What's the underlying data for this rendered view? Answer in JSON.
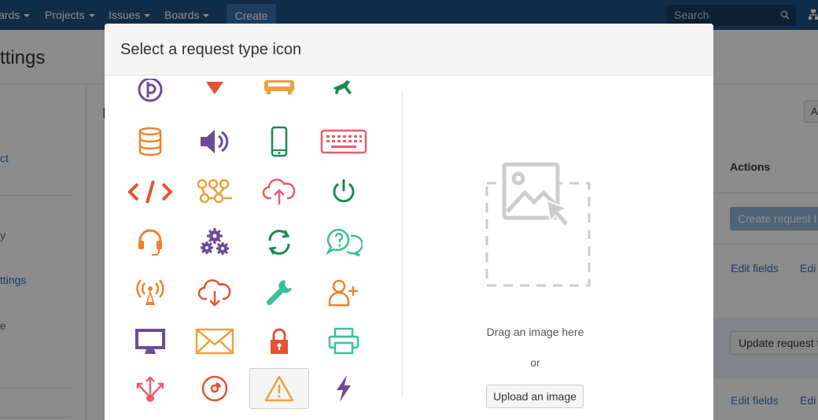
{
  "nav": {
    "items": [
      {
        "label": "ards"
      },
      {
        "label": "Projects"
      },
      {
        "label": "Issues"
      },
      {
        "label": "Boards"
      }
    ],
    "create_label": "Create",
    "search_placeholder": "Search"
  },
  "background": {
    "page_title": "ttings",
    "sidebar_links": [
      "ct",
      "y",
      "ttings",
      "e"
    ],
    "section_letter": "I",
    "small_button_label": "A",
    "actions_header": "Actions",
    "create_request_label": "Create request t",
    "edit_fields_label": "Edit fields",
    "edit_short_label": "Edi",
    "update_request_label": "Update request ty"
  },
  "modal": {
    "title": "Select a request type icon",
    "drop_text": "Drag an image here",
    "or_text": "or",
    "upload_label": "Upload an image"
  },
  "icons": [
    {
      "name": "currency-icon",
      "color": "#6b4c9a"
    },
    {
      "name": "heart-down-icon",
      "color": "#e5532f"
    },
    {
      "name": "couch-icon",
      "color": "#e8a23b"
    },
    {
      "name": "airplane-icon",
      "color": "#1b8a4c"
    },
    {
      "name": "database-icon",
      "color": "#f0812c"
    },
    {
      "name": "speaker-icon",
      "color": "#6b4c9a"
    },
    {
      "name": "mobile-icon",
      "color": "#1b8a4c"
    },
    {
      "name": "keyboard-icon",
      "color": "#ef5a6b"
    },
    {
      "name": "code-icon",
      "color": "#e5532f"
    },
    {
      "name": "workflow-icon",
      "color": "#e8a23b"
    },
    {
      "name": "cloud-upload-icon",
      "color": "#ef5a6b"
    },
    {
      "name": "power-icon",
      "color": "#1b8a4c"
    },
    {
      "name": "headset-icon",
      "color": "#f0812c"
    },
    {
      "name": "cogs-icon",
      "color": "#6b4c9a"
    },
    {
      "name": "refresh-icon",
      "color": "#1b8a4c"
    },
    {
      "name": "help-chat-icon",
      "color": "#3cbf9a"
    },
    {
      "name": "antenna-icon",
      "color": "#f0812c"
    },
    {
      "name": "cloud-download-icon",
      "color": "#e5532f"
    },
    {
      "name": "wrench-icon",
      "color": "#3cbf9a"
    },
    {
      "name": "add-user-icon",
      "color": "#f0812c"
    },
    {
      "name": "monitor-icon",
      "color": "#6b4c9a"
    },
    {
      "name": "envelope-icon",
      "color": "#e8a23b"
    },
    {
      "name": "lock-icon",
      "color": "#e5532f"
    },
    {
      "name": "printer-icon",
      "color": "#3cbf9a"
    },
    {
      "name": "share-nodes-icon",
      "color": "#ef5a6b"
    },
    {
      "name": "disc-icon",
      "color": "#e5532f"
    },
    {
      "name": "warning-icon",
      "color": "#e8a23b"
    },
    {
      "name": "lightning-icon",
      "color": "#6b4c9a"
    }
  ],
  "selected_icon": "warning-icon"
}
